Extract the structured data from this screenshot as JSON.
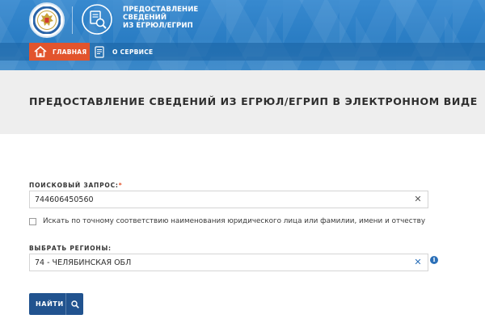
{
  "header": {
    "service_title_lines": [
      "ПРЕДОСТАВЛЕНИЕ",
      "СВЕДЕНИЙ",
      "ИЗ ЕГРЮЛ/ЕГРИП"
    ],
    "emblem_icon": "fns-emblem-icon",
    "service_icon": "document-search-icon"
  },
  "nav": {
    "items": [
      {
        "label": "ГЛАВНАЯ",
        "icon": "home-icon",
        "active": true
      },
      {
        "label": "О СЕРВИСЕ",
        "icon": "document-icon",
        "active": false
      }
    ]
  },
  "page": {
    "title": "ПРЕДОСТАВЛЕНИЕ СВЕДЕНИЙ ИЗ ЕГРЮЛ/ЕГРИП В ЭЛЕКТРОННОМ ВИДЕ"
  },
  "form": {
    "query_label": "ПОИСКОВЫЙ ЗАПРОС:",
    "query_required_mark": "*",
    "query_value": "744606450560",
    "exact_match_label": "Искать по точному соответствию наименования юридического лица или фамилии, имени и отчеству",
    "exact_match_checked": false,
    "region_label": "ВЫБРАТЬ РЕГИОНЫ:",
    "region_value": "74 - ЧЕЛЯБИНСКАЯ ОБЛ",
    "clear_glyph": "✕",
    "info_glyph": "i",
    "submit_label": "НАЙТИ"
  },
  "colors": {
    "header_blue": "#2a7dc4",
    "nav_active": "#e2542d",
    "button_blue": "#21538f",
    "title_band": "#eeeeee"
  }
}
